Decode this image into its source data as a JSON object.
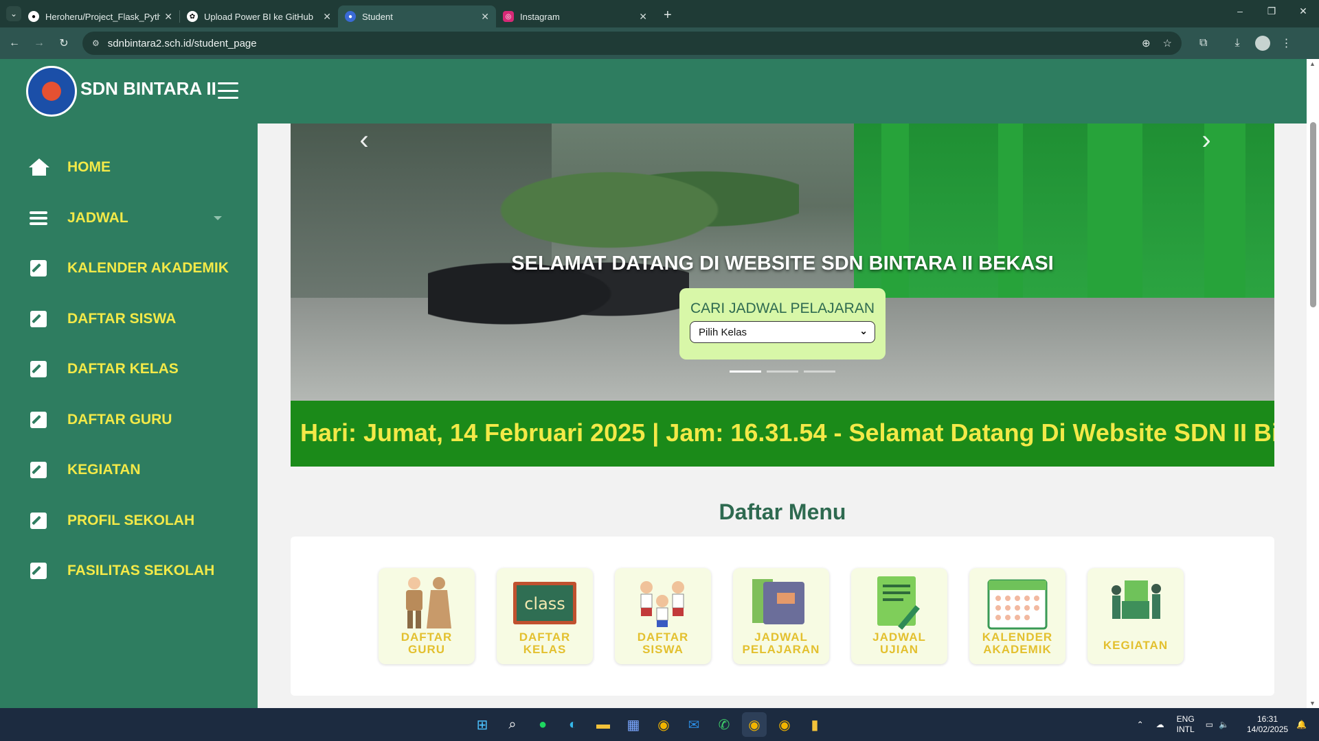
{
  "browser": {
    "tabs": [
      {
        "title": "Heroheru/Project_Flask_Python",
        "favicon": "github-icon",
        "active": false
      },
      {
        "title": "Upload Power BI ke GitHub",
        "favicon": "chatgpt-icon",
        "active": false
      },
      {
        "title": "Student",
        "favicon": "site-icon",
        "active": true
      },
      {
        "title": "Instagram",
        "favicon": "instagram-icon",
        "active": false
      }
    ],
    "url": "sdnbintara2.sch.id/student_page",
    "new_tab": "+",
    "window_controls": [
      "–",
      "❐",
      "✕"
    ]
  },
  "site": {
    "brand": "SDN BINTARA II",
    "colors": {
      "primary": "#2e7d60",
      "accent_text": "#f3e948",
      "ticker_bg": "#1b8a19"
    },
    "sidebar": [
      {
        "label": "HOME",
        "icon": "home-icon"
      },
      {
        "label": "JADWAL",
        "icon": "list-icon",
        "dropdown": true
      },
      {
        "label": "KALENDER AKADEMIK",
        "icon": "edit-icon"
      },
      {
        "label": "DAFTAR SISWA",
        "icon": "edit-icon"
      },
      {
        "label": "DAFTAR KELAS",
        "icon": "edit-icon"
      },
      {
        "label": "DAFTAR GURU",
        "icon": "edit-icon"
      },
      {
        "label": "KEGIATAN",
        "icon": "edit-icon"
      },
      {
        "label": "PROFIL SEKOLAH",
        "icon": "edit-icon"
      },
      {
        "label": "FASILITAS SEKOLAH",
        "icon": "edit-icon"
      }
    ],
    "hero": {
      "title": "SELAMAT DATANG DI WEBSITE SDN BINTARA II BEKASI",
      "search_title": "CARI JADWAL PELAJARAN",
      "select_value": "Pilih Kelas",
      "prev": "‹",
      "next": "›",
      "slides": 3,
      "active_slide": 1
    },
    "ticker": "Hari: Jumat, 14 Februari 2025 | Jam: 16.31.54 - Selamat Datang Di Website SDN II Bintara",
    "menu": {
      "title": "Daftar Menu",
      "items": [
        {
          "line1": "DAFTAR",
          "line2": "GURU"
        },
        {
          "line1": "DAFTAR",
          "line2": "KELAS"
        },
        {
          "line1": "DAFTAR",
          "line2": "SISWA"
        },
        {
          "line1": "JADWAL",
          "line2": "PELAJARAN"
        },
        {
          "line1": "JADWAL",
          "line2": "UJIAN"
        },
        {
          "line1": "KALENDER",
          "line2": "AKADEMIK"
        },
        {
          "line1": "KEGIATAN",
          "line2": ""
        }
      ],
      "class_art_text": "class"
    }
  },
  "taskbar": {
    "lang1": "ENG",
    "lang2": "INTL",
    "time": "16:31",
    "date": "14/02/2025"
  }
}
